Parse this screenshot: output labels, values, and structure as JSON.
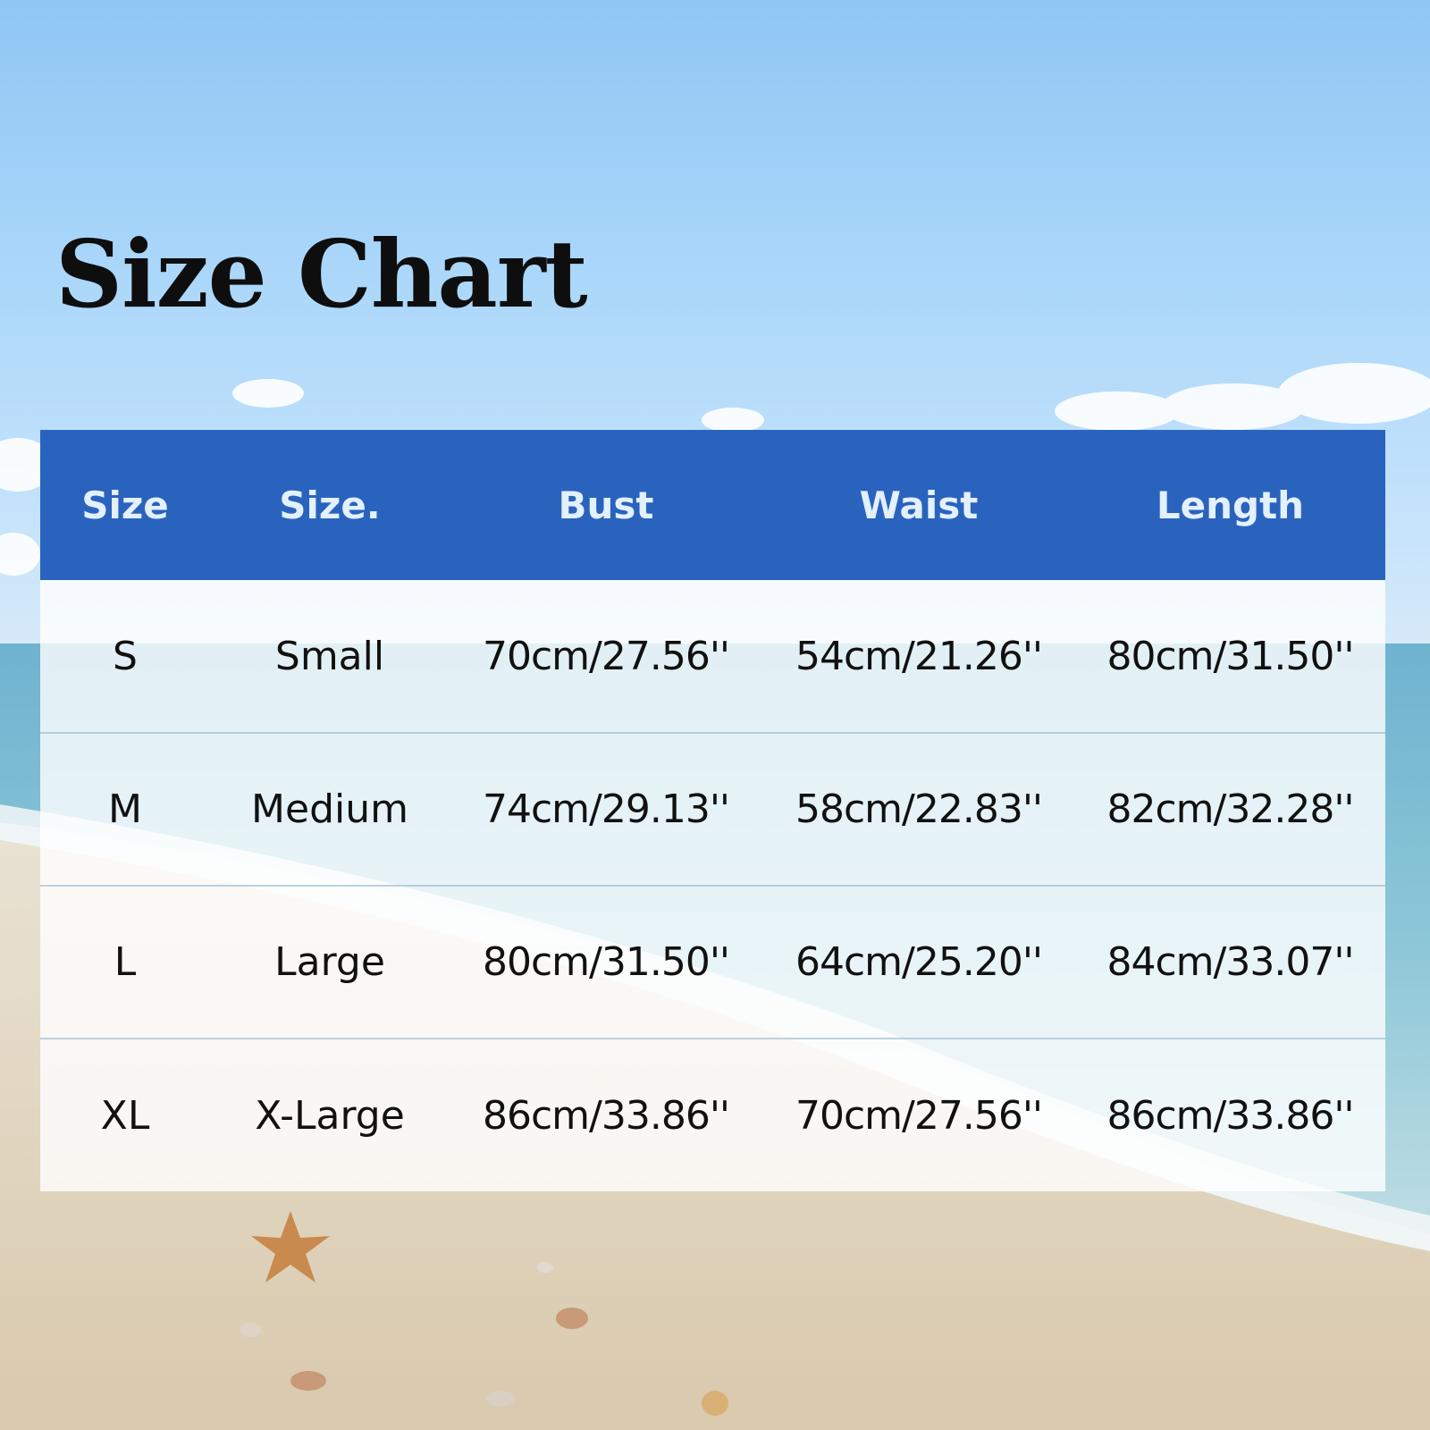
{
  "title": "Size Chart",
  "colors": {
    "header_background": "#2a63be",
    "header_text": "#e3f0fd",
    "cell_text": "#111111",
    "title_text": "#0e0e0e"
  },
  "background_scene": "beach-with-sky-sea-sand-and-starfish",
  "table": {
    "headers": [
      "Size",
      "Size.",
      "Bust",
      "Waist",
      "Length"
    ],
    "rows": [
      [
        "S",
        "Small",
        "70cm/27.56''",
        "54cm/21.26''",
        "80cm/31.50''"
      ],
      [
        "M",
        "Medium",
        "74cm/29.13''",
        "58cm/22.83''",
        "82cm/32.28''"
      ],
      [
        "L",
        "Large",
        "80cm/31.50''",
        "64cm/25.20''",
        "84cm/33.07''"
      ],
      [
        "XL",
        "X-Large",
        "86cm/33.86''",
        "70cm/27.56''",
        "86cm/33.86''"
      ]
    ]
  }
}
